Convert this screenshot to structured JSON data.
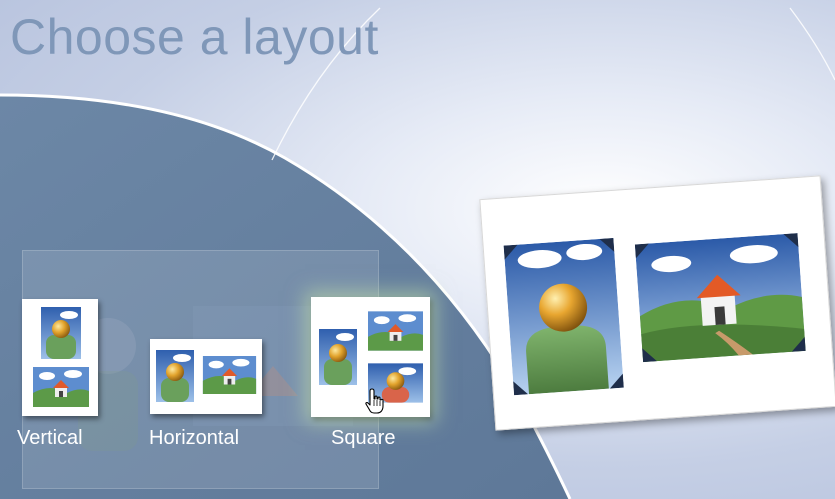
{
  "slide": {
    "title": "Choose a layout"
  },
  "layouts": [
    {
      "label": "Vertical"
    },
    {
      "label": "Horizontal"
    },
    {
      "label": "Square"
    }
  ],
  "icons": {
    "person": "person-photo-icon",
    "house": "house-photo-icon",
    "pointer": "hand-pointer-icon"
  },
  "colors": {
    "title": "#7f97b8",
    "panel": "#6d87a6",
    "label": "#ffffff"
  }
}
